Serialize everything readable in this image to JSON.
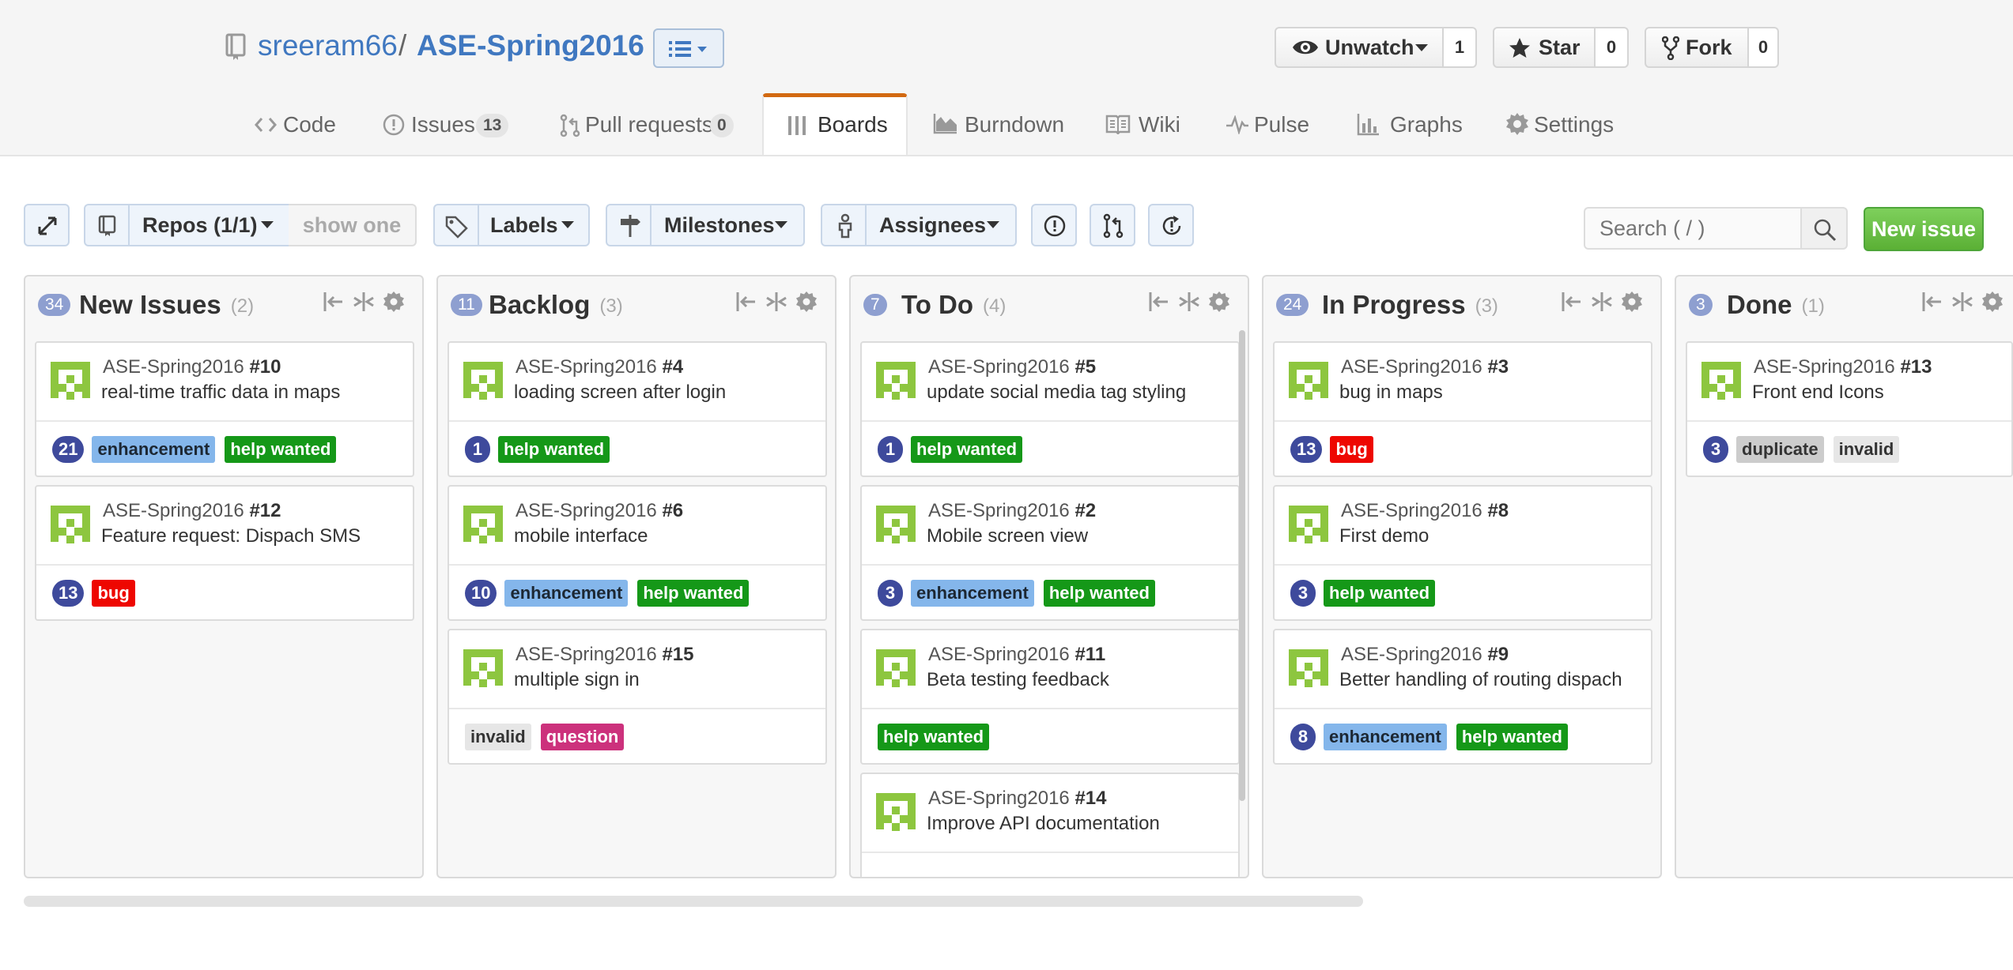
{
  "repo": {
    "owner": "sreeram66",
    "separator": "/",
    "name": "ASE-Spring2016"
  },
  "actions": {
    "unwatch": {
      "label": "Unwatch",
      "count": "1"
    },
    "star": {
      "label": "Star",
      "count": "0"
    },
    "fork": {
      "label": "Fork",
      "count": "0"
    }
  },
  "nav": {
    "code": "Code",
    "issues": "Issues",
    "issues_count": "13",
    "pulls": "Pull requests",
    "pulls_count": "0",
    "boards": "Boards",
    "burndown": "Burndown",
    "wiki": "Wiki",
    "pulse": "Pulse",
    "graphs": "Graphs",
    "settings": "Settings",
    "selected": "Boards"
  },
  "toolbar": {
    "repos": "Repos (1/1)",
    "show_one": "show one",
    "labels": "Labels",
    "milestones": "Milestones",
    "assignees": "Assignees",
    "search_placeholder": "Search ( / )",
    "new_issue": "New issue"
  },
  "colors": {
    "link": "#4078c0",
    "accent_tab": "#d26911",
    "count_badge": "#3e4a9c",
    "enhancement": "#84b6eb",
    "help_wanted": "#159818",
    "bug": "#ee0701",
    "question": "#cc317c",
    "invalid": "#e6e6e6",
    "duplicate": "#cccccc",
    "new_issue": "#6cc644"
  },
  "columns": [
    {
      "count": "34",
      "title": "New Issues",
      "sub": "(2)",
      "cards": [
        {
          "repo": "ASE-Spring2016",
          "num": "#10",
          "title": "real-time traffic data in maps",
          "badge": "21",
          "labels": [
            {
              "text": "enhancement",
              "kind": "enh"
            },
            {
              "text": "help wanted",
              "kind": "help"
            }
          ]
        },
        {
          "repo": "ASE-Spring2016",
          "num": "#12",
          "title": "Feature request: Dispach SMS",
          "badge": "13",
          "labels": [
            {
              "text": "bug",
              "kind": "bug"
            }
          ]
        }
      ]
    },
    {
      "count": "11",
      "title": "Backlog",
      "sub": "(3)",
      "cards": [
        {
          "repo": "ASE-Spring2016",
          "num": "#4",
          "title": "loading screen after login",
          "badge": "1",
          "labels": [
            {
              "text": "help wanted",
              "kind": "help"
            }
          ]
        },
        {
          "repo": "ASE-Spring2016",
          "num": "#6",
          "title": "mobile interface",
          "badge": "10",
          "labels": [
            {
              "text": "enhancement",
              "kind": "enh"
            },
            {
              "text": "help wanted",
              "kind": "help"
            }
          ]
        },
        {
          "repo": "ASE-Spring2016",
          "num": "#15",
          "title": "multiple sign in",
          "badge": "",
          "labels": [
            {
              "text": "invalid",
              "kind": "inv"
            },
            {
              "text": "question",
              "kind": "q"
            }
          ]
        }
      ]
    },
    {
      "count": "7",
      "title": "To Do",
      "sub": "(4)",
      "cards": [
        {
          "repo": "ASE-Spring2016",
          "num": "#5",
          "title": "update social media tag styling",
          "badge": "1",
          "labels": [
            {
              "text": "help wanted",
              "kind": "help"
            }
          ]
        },
        {
          "repo": "ASE-Spring2016",
          "num": "#2",
          "title": "Mobile screen view",
          "badge": "3",
          "labels": [
            {
              "text": "enhancement",
              "kind": "enh"
            },
            {
              "text": "help wanted",
              "kind": "help"
            }
          ]
        },
        {
          "repo": "ASE-Spring2016",
          "num": "#11",
          "title": "Beta testing feedback",
          "badge": "",
          "labels": [
            {
              "text": "help wanted",
              "kind": "help"
            }
          ]
        },
        {
          "repo": "ASE-Spring2016",
          "num": "#14",
          "title": "Improve API documentation",
          "badge": "",
          "labels": []
        }
      ]
    },
    {
      "count": "24",
      "title": "In Progress",
      "sub": "(3)",
      "cards": [
        {
          "repo": "ASE-Spring2016",
          "num": "#3",
          "title": "bug in maps",
          "badge": "13",
          "labels": [
            {
              "text": "bug",
              "kind": "bug"
            }
          ]
        },
        {
          "repo": "ASE-Spring2016",
          "num": "#8",
          "title": "First demo",
          "badge": "3",
          "labels": [
            {
              "text": "help wanted",
              "kind": "help"
            }
          ]
        },
        {
          "repo": "ASE-Spring2016",
          "num": "#9",
          "title": "Better handling of routing dispach",
          "badge": "8",
          "labels": [
            {
              "text": "enhancement",
              "kind": "enh"
            },
            {
              "text": "help wanted",
              "kind": "help"
            }
          ]
        }
      ]
    },
    {
      "count": "3",
      "title": "Done",
      "sub": "(1)",
      "cards": [
        {
          "repo": "ASE-Spring2016",
          "num": "#13",
          "title": "Front end Icons",
          "badge": "3",
          "labels": [
            {
              "text": "duplicate",
              "kind": "dup"
            },
            {
              "text": "invalid",
              "kind": "inv"
            }
          ]
        }
      ]
    }
  ]
}
